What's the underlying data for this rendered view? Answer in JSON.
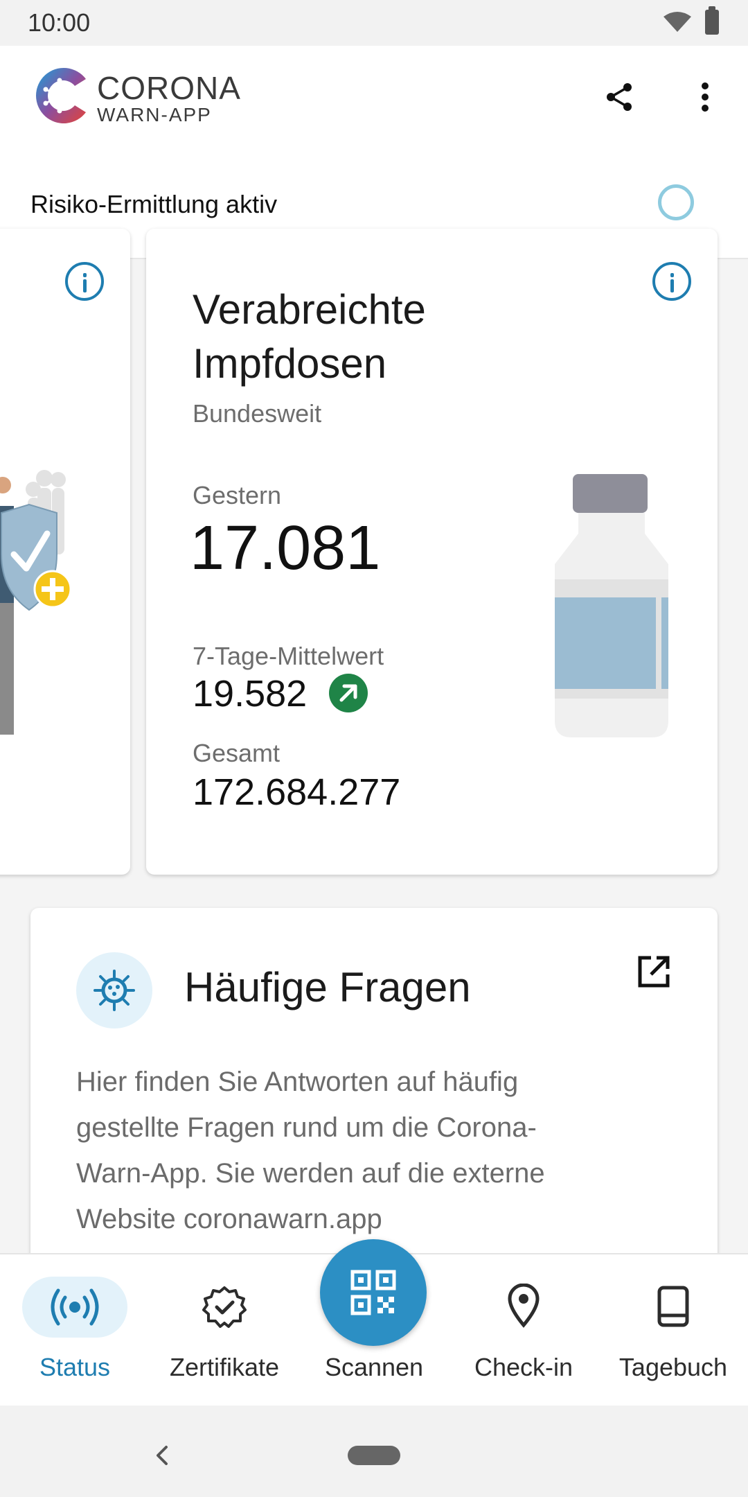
{
  "status_bar": {
    "time": "10:00"
  },
  "app": {
    "logo_title": "CORONA",
    "logo_subtitle": "WARN-APP"
  },
  "risk": {
    "label": "Risiko-Ermittlung aktiv"
  },
  "vaccination_card": {
    "title_line1": "Verabreichte",
    "title_line2": "Impfdosen",
    "region": "Bundesweit",
    "yesterday_label": "Gestern",
    "yesterday_value": "17.081",
    "avg_label": "7-Tage-Mittelwert",
    "avg_value": "19.582",
    "total_label": "Gesamt",
    "total_value": "172.684.277"
  },
  "faq_card": {
    "title": "Häufige Fragen",
    "body": "Hier finden Sie Antworten auf häufig gestellte Fragen rund um die Corona-Warn-App. Sie werden auf die externe Website coronawarn.app"
  },
  "nav": {
    "items": [
      {
        "label": "Status",
        "icon": "radar-icon",
        "active": true
      },
      {
        "label": "Zertifikate",
        "icon": "certificate-icon"
      },
      {
        "label": "Scannen",
        "icon": "qr-code-icon"
      },
      {
        "label": "Check-in",
        "icon": "location-pin-icon"
      },
      {
        "label": "Tagebuch",
        "icon": "diary-icon"
      }
    ]
  },
  "colors": {
    "accent": "#2c8fc4",
    "active_nav": "#1e7db0",
    "trend_up": "#1f8447",
    "risk_ring": "#8ecbdf"
  }
}
